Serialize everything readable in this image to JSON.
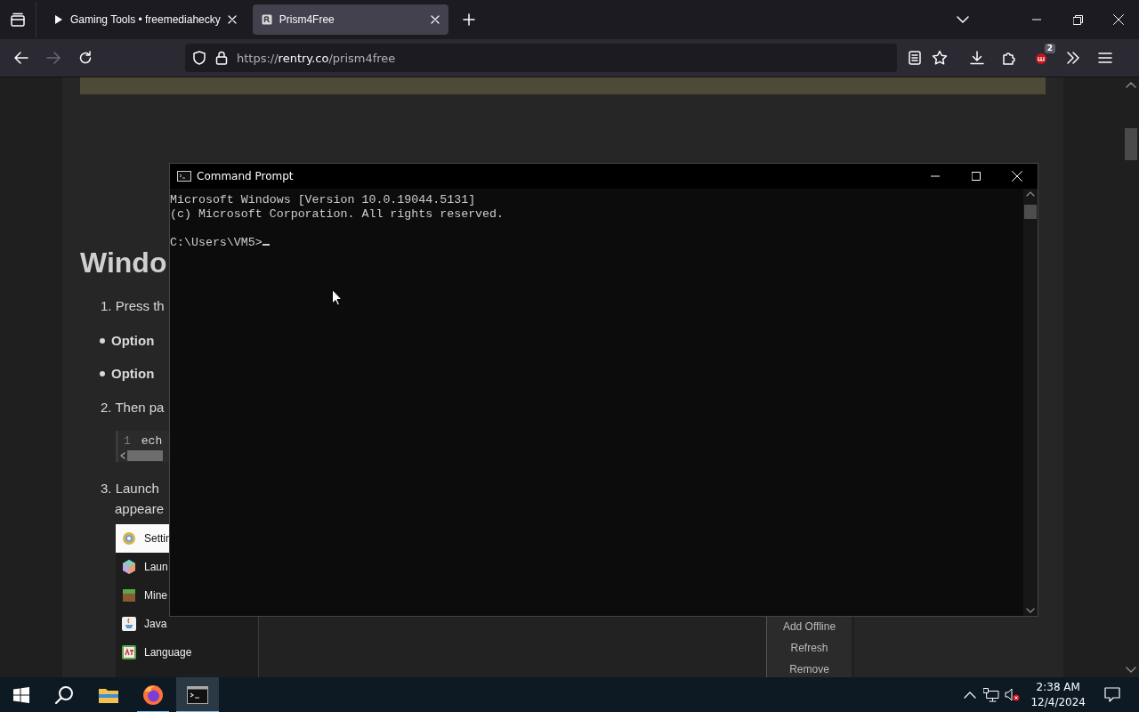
{
  "browser": {
    "tabs": [
      {
        "title": "Gaming Tools • freemediahecky",
        "selected": false,
        "playing": true
      },
      {
        "title": "Prism4Free",
        "selected": true,
        "playing": false
      }
    ],
    "url": {
      "scheme": "https://",
      "domain": "rentry.co",
      "path": "/prism4free"
    },
    "extension_badge": "2"
  },
  "page": {
    "heading": "Windo",
    "blocks": [
      {
        "kind": "step",
        "text": "1. Press th"
      },
      {
        "kind": "bullet",
        "text": "Option"
      },
      {
        "kind": "bullet",
        "text": "Option"
      },
      {
        "kind": "step",
        "text": "2. Then pa"
      },
      {
        "kind": "code",
        "line_number": "1",
        "text": "ech"
      },
      {
        "kind": "step",
        "text": "3. Launch"
      },
      {
        "kind": "continuation",
        "text": "appeare"
      }
    ],
    "settings_screenshot": {
      "sidebar_items": [
        {
          "label": "Settin",
          "selected": true
        },
        {
          "label": "Laun",
          "selected": false
        },
        {
          "label": "Mine",
          "selected": false
        },
        {
          "label": "Java",
          "selected": false
        },
        {
          "label": "Language",
          "selected": false
        }
      ],
      "buttons": [
        "Add Offline",
        "Refresh",
        "Remove"
      ]
    }
  },
  "console": {
    "title": "Command Prompt",
    "output": [
      "Microsoft Windows [Version 10.0.19044.5131]",
      "(c) Microsoft Corporation. All rights reserved."
    ],
    "prompt": "C:\\Users\\VM5>"
  },
  "taskbar": {
    "apps": [
      {
        "kind": "explorer",
        "running": false,
        "selected": false
      },
      {
        "kind": "firefox",
        "running": true,
        "selected": false
      },
      {
        "kind": "console",
        "running": true,
        "selected": true
      }
    ],
    "time": "2:38 AM",
    "date": "12/4/2024"
  }
}
